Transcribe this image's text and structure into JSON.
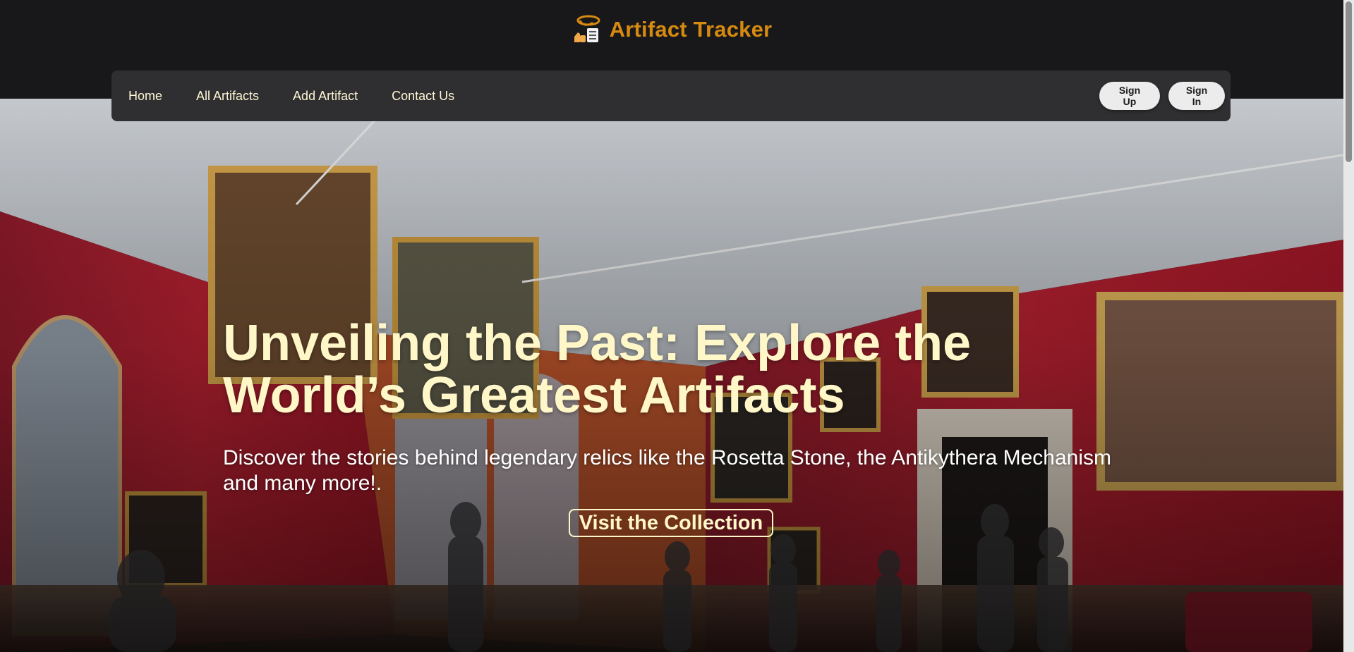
{
  "brand": {
    "title": "Artifact Tracker",
    "logo_icon": "artifact-scroll-icon",
    "accent": "#d68a10"
  },
  "nav": {
    "links": [
      "Home",
      "All Artifacts",
      "Add Artifact",
      "Contact Us"
    ],
    "sign_up": "Sign Up",
    "sign_in": "Sign In"
  },
  "hero": {
    "title": "Unveiling the Past: Explore the World’s Greatest Artifacts",
    "subtitle": "Discover the stories behind legendary relics like the Rosetta Stone, the Antikythera Mechanism and many more!.",
    "cta": "Visit the Collection"
  },
  "colors": {
    "nav_bg": "#2f2e30",
    "title_text": "#fff7c8",
    "top_bg": "#18181b"
  }
}
